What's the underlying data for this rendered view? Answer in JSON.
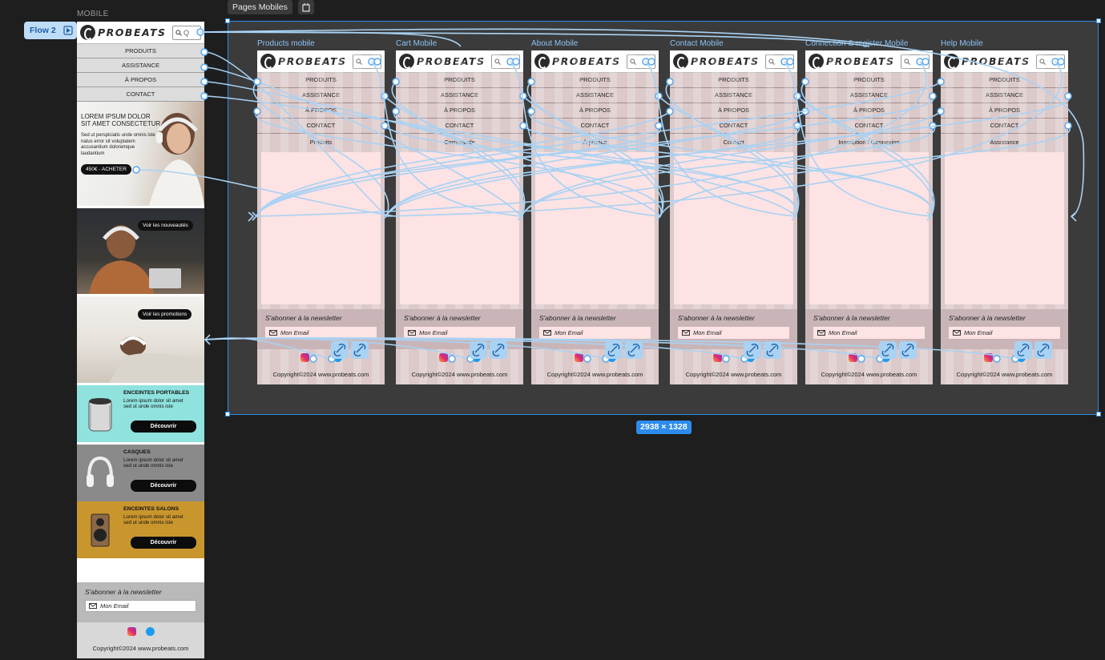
{
  "canvas": {
    "section_label": "MOBILE",
    "flow_label": "Flow 2",
    "page_tab": "Pages Mobiles",
    "selection_size": "2938 × 1328"
  },
  "brand": {
    "name": "PROBEATS"
  },
  "mobile_home": {
    "search_placeholder": "Q",
    "nav": [
      "PRODUITS",
      "ASSISTANCE",
      "À PROPOS",
      "CONTACT"
    ],
    "hero": {
      "title": "LOREM IPSUM DOLOR SIT AMET CONSECTETUR",
      "text": "Sed ut perspiciatis unde omnis iste natus error sit voluptatem accusantium doloremque laudantium",
      "cta": "450€ - ACHETER"
    },
    "promo1": {
      "cta": "Voir les nouveautés"
    },
    "promo2": {
      "cta": "Voir les promotions"
    },
    "products": [
      {
        "title": "ENCEINTES PORTABLES",
        "text": "Lorem ipsum dolor sit amet sed ut unde omnis iste",
        "cta": "Découvrir",
        "bg": "#8fe2de"
      },
      {
        "title": "CASQUES",
        "text": "Lorem ipsum dolor sit amet sed ut unde omnis iste",
        "cta": "Découvrir",
        "bg": "#8a8a8a"
      },
      {
        "title": "ENCEINTES SALONS",
        "text": "Lorem ipsum dolor sit amet sed ut unde omnis iste",
        "cta": "Découvrir",
        "bg": "#c9962e"
      }
    ],
    "newsletter": {
      "title": "S'abonner à la newsletter",
      "placeholder": "Mon Email"
    },
    "copyright": "Copyright©2024 www.probeats.com"
  },
  "frames": [
    {
      "label": "Products mobile",
      "subtitle": "Produits"
    },
    {
      "label": "Cart Mobile",
      "subtitle": "Commande"
    },
    {
      "label": "About Mobile",
      "subtitle": "À propos"
    },
    {
      "label": "Contact Mobile",
      "subtitle": "Contact"
    },
    {
      "label": "Connection & register Mobile",
      "subtitle": "Inscription / Connexion"
    },
    {
      "label": "Help Mobile",
      "subtitle": "Assistance"
    }
  ],
  "frame_nav": [
    "PRODUITS",
    "ASSISTANCE",
    "À PROPOS",
    "CONTACT"
  ],
  "frame_newsletter": {
    "title": "S'abonner à la newsletter",
    "placeholder": "Mon Email"
  },
  "frame_copyright": "Copyright©2024 www.probeats.com",
  "colors": {
    "accent": "#2d8ceb",
    "connector": "#a9d2f3",
    "frame_bg": "#dcc9ca"
  }
}
